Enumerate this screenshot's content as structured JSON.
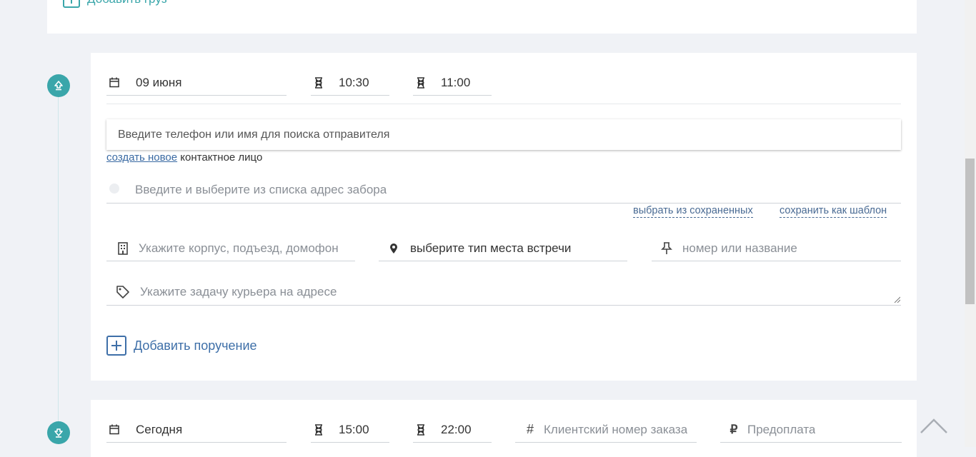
{
  "top": {
    "add_cargo_label": "Добавить груз"
  },
  "pickup": {
    "date": "09 июня",
    "time_from": "10:30",
    "time_to": "11:00",
    "sender_search_placeholder": "Введите телефон или имя для поиска отправителя",
    "create_new_link": "создать новое",
    "contact_suffix": " контактное лицо",
    "address_placeholder": "Введите и выберите из списка адрес забора",
    "choose_saved_link": "выбрать из сохраненных",
    "save_template_link": "сохранить как шаблон",
    "building_placeholder": "Укажите корпус, подъезд, домофон",
    "meeting_type_value": "выберите тип места встречи",
    "place_name_placeholder": "номер или название",
    "courier_task_placeholder": "Укажите задачу курьера на адресе",
    "add_task_label": "Добавить поручение"
  },
  "delivery": {
    "date": "Сегодня",
    "time_from": "15:00",
    "time_to": "22:00",
    "client_order_placeholder": "Клиентский номер заказа",
    "prepayment_placeholder": "Предоплата"
  },
  "icons": {
    "pickup_step": "upload-arrow-icon",
    "delivery_step": "download-arrow-icon",
    "date": "calendar-icon",
    "time": "hourglass-icon",
    "building": "building-icon",
    "location": "map-pin-icon",
    "pushpin": "pushpin-icon",
    "tag": "tag-icon",
    "hash": "hash-icon",
    "ruble": "ruble-icon",
    "scroll_up": "chevron-up-icon"
  },
  "colors": {
    "accent_teal": "#3aa6aa",
    "link_blue": "#3a6aa3",
    "background": "#f0f2f6"
  }
}
